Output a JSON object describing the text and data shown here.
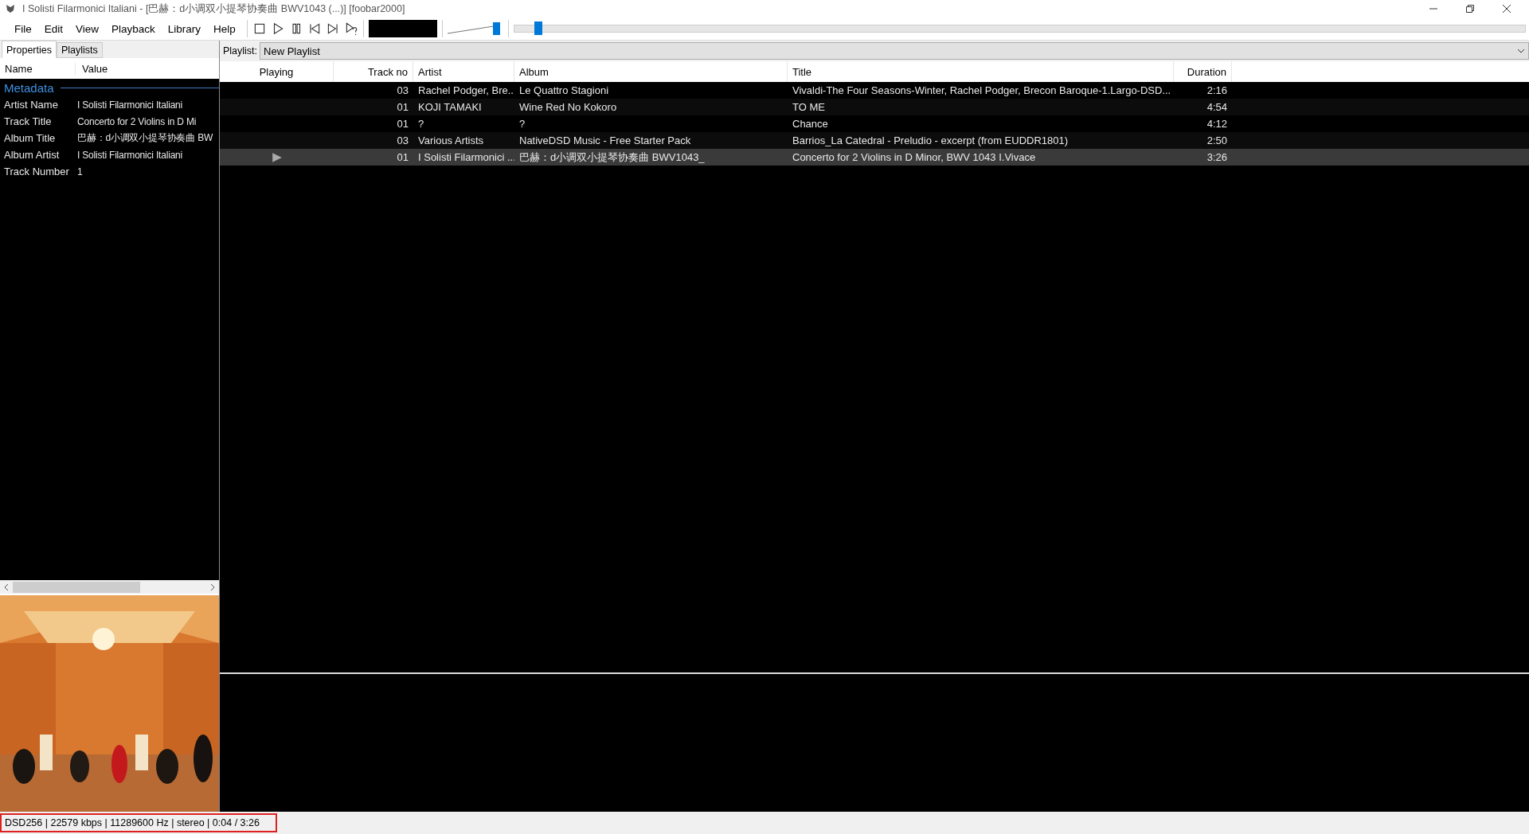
{
  "window": {
    "title": "I Solisti Filarmonici Italiani - [巴赫：d小调双小提琴协奏曲 BWV1043 (...)]  [foobar2000]"
  },
  "menu": [
    {
      "label": "File"
    },
    {
      "label": "Edit"
    },
    {
      "label": "View"
    },
    {
      "label": "Playback"
    },
    {
      "label": "Library"
    },
    {
      "label": "Help"
    }
  ],
  "transport": [
    {
      "kind": "stop"
    },
    {
      "kind": "play"
    },
    {
      "kind": "pause"
    },
    {
      "kind": "prev"
    },
    {
      "kind": "next"
    },
    {
      "kind": "random"
    }
  ],
  "volume": {
    "level": 0.95
  },
  "seek": {
    "level": 0.02
  },
  "left_tabs": [
    {
      "label": "Properties",
      "selected": true
    },
    {
      "label": "Playlists",
      "selected": false
    }
  ],
  "properties": {
    "columns": [
      "Name",
      "Value"
    ],
    "section": "Metadata",
    "rows": [
      {
        "name": "Artist Name",
        "value": "I Solisti Filarmonici Italiani"
      },
      {
        "name": "Track Title",
        "value": "Concerto for 2 Violins in D Mi"
      },
      {
        "name": "Album Title",
        "value": "巴赫：d小调双小提琴协奏曲 BW"
      },
      {
        "name": "Album Artist",
        "value": "I Solisti Filarmonici Italiani"
      },
      {
        "name": "Track Number",
        "value": "1"
      }
    ]
  },
  "playlist_bar": {
    "label": "Playlist:",
    "value": "New Playlist"
  },
  "playlist": {
    "columns": [
      "Playing",
      "Track no",
      "Artist",
      "Album",
      "Title",
      "Duration"
    ],
    "rows": [
      {
        "playing": false,
        "selected": false,
        "track": "03",
        "artist": "Rachel Podger, Bre...",
        "album": "Le Quattro Stagioni",
        "title": "Vivaldi-The Four Seasons-Winter, Rachel Podger, Brecon Baroque-1.Largo-DSD...",
        "duration": "2:16"
      },
      {
        "playing": false,
        "selected": false,
        "track": "01",
        "artist": "KOJI TAMAKI",
        "album": "Wine Red No Kokoro",
        "title": "TO ME",
        "duration": "4:54"
      },
      {
        "playing": false,
        "selected": false,
        "track": "01",
        "artist": "?",
        "album": "?",
        "title": "Chance",
        "duration": "4:12"
      },
      {
        "playing": false,
        "selected": false,
        "track": "03",
        "artist": "Various Artists",
        "album": "NativeDSD Music - Free Starter Pack",
        "title": "Barrios_La Catedral - Preludio - excerpt (from EUDDR1801)",
        "duration": "2:50"
      },
      {
        "playing": true,
        "selected": true,
        "track": "01",
        "artist": "I Solisti Filarmonici ...",
        "album": "巴赫：d小调双小提琴协奏曲 BWV1043_",
        "title": "Concerto for 2 Violins in D Minor, BWV 1043 I.Vivace",
        "duration": "3:26"
      }
    ]
  },
  "status_bar": {
    "text": "DSD256 | 22579 kbps | 11289600 Hz | stereo | 0:04 / 3:26",
    "highlighted": true
  }
}
